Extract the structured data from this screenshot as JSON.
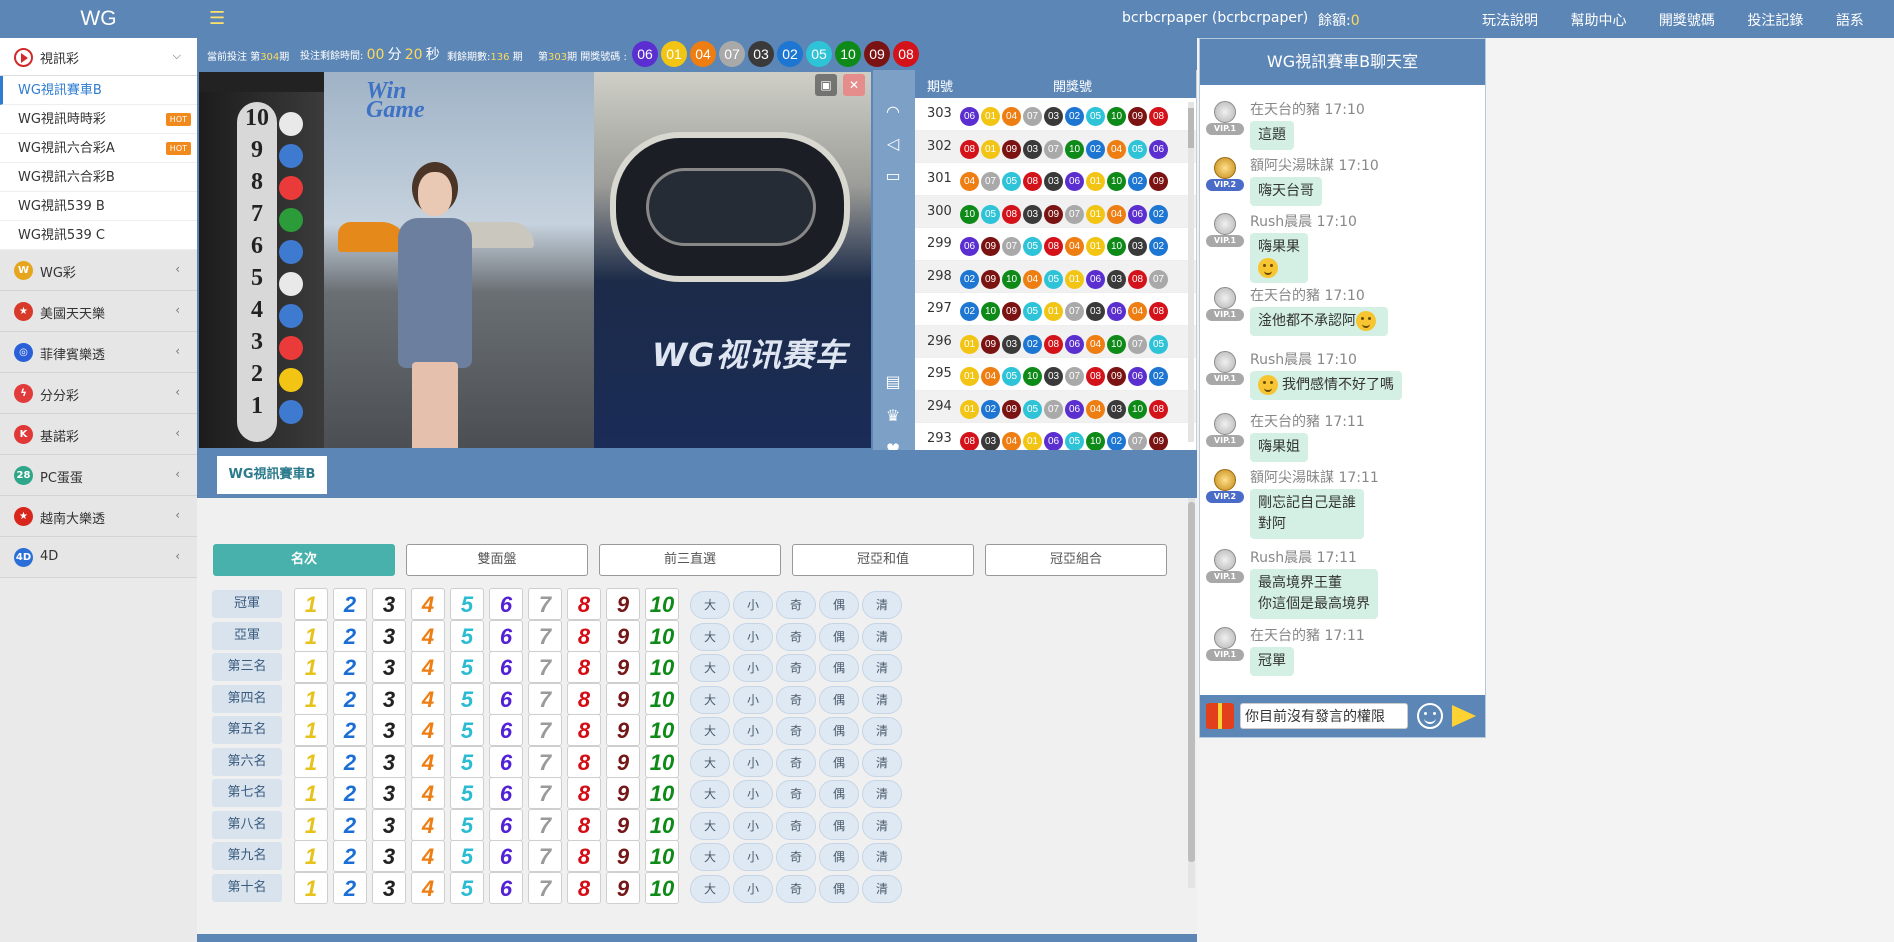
{
  "topbar": {
    "logo": "WG",
    "user": "bcrbcrpaper (bcrbcrpaper)",
    "balance_label": "餘額:",
    "balance_value": "0",
    "nav": [
      "玩法說明",
      "幫助中心",
      "開獎號碼",
      "投注記錄",
      "語系"
    ]
  },
  "sidebar": {
    "open_category": "視訊彩",
    "sub_items": [
      {
        "label": "WG視訊賽車B",
        "active": true,
        "hot": ""
      },
      {
        "label": "WG視訊時時彩",
        "active": false,
        "hot": "HOT"
      },
      {
        "label": "WG視訊六合彩A",
        "active": false,
        "hot": "HOT"
      },
      {
        "label": "WG視訊六合彩B",
        "active": false,
        "hot": ""
      },
      {
        "label": "WG視訊539 B",
        "active": false,
        "hot": ""
      },
      {
        "label": "WG視訊539 C",
        "active": false,
        "hot": ""
      }
    ],
    "categories": [
      {
        "label": "WG彩",
        "icon_text": "W",
        "color": "#e6a51c"
      },
      {
        "label": "美國天天樂",
        "icon_text": "★",
        "color": "#d83a2a"
      },
      {
        "label": "菲律賓樂透",
        "icon_text": "◎",
        "color": "#2a5fd8"
      },
      {
        "label": "分分彩",
        "icon_text": "ϟ",
        "color": "#e23b3b"
      },
      {
        "label": "基諾彩",
        "icon_text": "K",
        "color": "#e03737"
      },
      {
        "label": "PC蛋蛋",
        "icon_text": "28",
        "color": "#2fa68a"
      },
      {
        "label": "越南大樂透",
        "icon_text": "★",
        "color": "#d9261c"
      },
      {
        "label": "4D",
        "icon_text": "4D",
        "color": "#2a6fd8"
      }
    ]
  },
  "infobar": {
    "current_label": "當前投注 第",
    "current_period": "304",
    "current_suffix": "期",
    "countdown_label": "投注剩餘時間:",
    "hh": "00",
    "h_unit": "分",
    "mm": "20",
    "m_unit": "秒",
    "remain_label": "剩餘期數:",
    "remain_value": "136",
    "remain_suffix": "期",
    "last_prefix": "第",
    "last_period": "303",
    "last_suffix": "期 開獎號碼 :",
    "latest_balls": [
      "06",
      "01",
      "04",
      "07",
      "03",
      "02",
      "05",
      "10",
      "09",
      "08"
    ]
  },
  "video": {
    "logo_top": "Win",
    "logo_bottom": "Game",
    "title": "WG视讯赛车",
    "tube_numbers": [
      "10",
      "9",
      "8",
      "7",
      "6",
      "5",
      "4",
      "3",
      "2",
      "1"
    ]
  },
  "history": {
    "col_period": "期號",
    "col_numbers": "開獎號",
    "rows": [
      {
        "p": "303",
        "n": [
          "06",
          "01",
          "04",
          "07",
          "03",
          "02",
          "05",
          "10",
          "09",
          "08"
        ]
      },
      {
        "p": "302",
        "n": [
          "08",
          "01",
          "09",
          "03",
          "07",
          "10",
          "02",
          "04",
          "05",
          "06"
        ]
      },
      {
        "p": "301",
        "n": [
          "04",
          "07",
          "05",
          "08",
          "03",
          "06",
          "01",
          "10",
          "02",
          "09"
        ]
      },
      {
        "p": "300",
        "n": [
          "10",
          "05",
          "08",
          "03",
          "09",
          "07",
          "01",
          "04",
          "06",
          "02"
        ]
      },
      {
        "p": "299",
        "n": [
          "06",
          "09",
          "07",
          "05",
          "08",
          "04",
          "01",
          "10",
          "03",
          "02"
        ]
      },
      {
        "p": "298",
        "n": [
          "02",
          "09",
          "10",
          "04",
          "05",
          "01",
          "06",
          "03",
          "08",
          "07"
        ]
      },
      {
        "p": "297",
        "n": [
          "02",
          "10",
          "09",
          "05",
          "01",
          "07",
          "03",
          "06",
          "04",
          "08"
        ]
      },
      {
        "p": "296",
        "n": [
          "01",
          "09",
          "03",
          "02",
          "08",
          "06",
          "04",
          "10",
          "07",
          "05"
        ]
      },
      {
        "p": "295",
        "n": [
          "01",
          "04",
          "05",
          "10",
          "03",
          "07",
          "08",
          "09",
          "06",
          "02"
        ]
      },
      {
        "p": "294",
        "n": [
          "01",
          "02",
          "09",
          "05",
          "07",
          "06",
          "04",
          "03",
          "10",
          "08"
        ]
      },
      {
        "p": "293",
        "n": [
          "08",
          "03",
          "04",
          "01",
          "06",
          "05",
          "10",
          "02",
          "07",
          "09"
        ]
      }
    ]
  },
  "ball_colors": {
    "01": "#f2c515",
    "02": "#1d76d2",
    "03": "#3a3a3a",
    "04": "#ee7d12",
    "05": "#2fc3d8",
    "06": "#5b2ed0",
    "07": "#a9a9a9",
    "08": "#d4121a",
    "09": "#7b1313",
    "10": "#0e8a18"
  },
  "bet": {
    "game_tab": "WG視訊賽車B",
    "modes": [
      "名次",
      "雙面盤",
      "前三直選",
      "冠亞和值",
      "冠亞組合"
    ],
    "rows": [
      "冠軍",
      "亞軍",
      "第三名",
      "第四名",
      "第五名",
      "第六名",
      "第七名",
      "第八名",
      "第九名",
      "第十名"
    ],
    "numbers": [
      "1",
      "2",
      "3",
      "4",
      "5",
      "6",
      "7",
      "8",
      "9",
      "10"
    ],
    "number_colors": [
      "#e6c21b",
      "#1b6fd4",
      "#222222",
      "#ee7d12",
      "#2bbbd2",
      "#5422d6",
      "#9a9a9a",
      "#d40d14",
      "#741717",
      "#0e8a18"
    ],
    "options": [
      "大",
      "小",
      "奇",
      "偶",
      "清"
    ]
  },
  "chat": {
    "title": "WG視訊賽車B聊天室",
    "messages": [
      {
        "name": "在天台的豬 17:10",
        "text": "這題",
        "vip": "VIP.1",
        "gold": false,
        "emoji": false,
        "emoji_after": false
      },
      {
        "name": "額阿尖湯昧謀 17:10",
        "text": "嗨天台哥",
        "vip": "VIP.2",
        "gold": true,
        "emoji": false,
        "emoji_after": false
      },
      {
        "name": "Rush晨晨 17:10",
        "text": "嗨果果",
        "vip": "VIP.1",
        "gold": false,
        "emoji": false,
        "emoji_after": false,
        "extra_emoji": true
      },
      {
        "name": "在天台的豬 17:10",
        "text": "淦他都不承認阿",
        "vip": "VIP.1",
        "gold": false,
        "emoji": false,
        "emoji_after": true
      },
      {
        "name": "Rush晨晨 17:10",
        "text": "我們感情不好了嗎",
        "vip": "VIP.1",
        "gold": false,
        "emoji": true,
        "emoji_after": false
      },
      {
        "name": "在天台的豬 17:11",
        "text": "嗨果姐",
        "vip": "VIP.1",
        "gold": false,
        "emoji": false,
        "emoji_after": false
      },
      {
        "name": "額阿尖湯昧謀 17:11",
        "text": "剛忘記自己是誰",
        "text2": "對阿",
        "vip": "VIP.2",
        "gold": true,
        "emoji": false,
        "emoji_after": false
      },
      {
        "name": "Rush晨晨 17:11",
        "text": "最高境界王董",
        "text2": "你這個是最高境界",
        "vip": "VIP.1",
        "gold": false,
        "emoji": false,
        "emoji_after": false
      },
      {
        "name": "在天台的豬 17:11",
        "text": "冠單",
        "vip": "VIP.1",
        "gold": false,
        "emoji": false,
        "emoji_after": false
      }
    ],
    "input_placeholder": "你目前沒有發言的權限"
  }
}
